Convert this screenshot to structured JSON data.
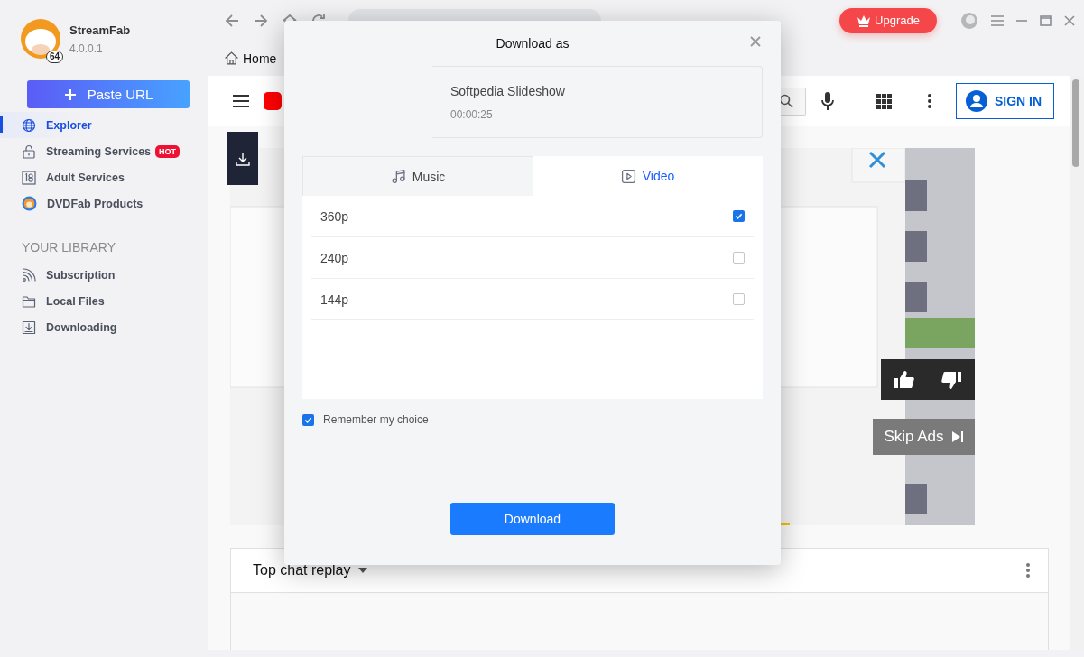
{
  "sidebar": {
    "app_name": "StreamFab",
    "version": "4.0.0.1",
    "logo_badge": "64",
    "paste_button": "Paste URL",
    "nav": [
      {
        "label": "Explorer",
        "selected": true
      },
      {
        "label": "Streaming Services",
        "badge": "HOT",
        "selected": false
      },
      {
        "label": "Adult Services",
        "selected": false
      },
      {
        "label": "DVDFab Products",
        "selected": false
      }
    ],
    "library_heading": "YOUR LIBRARY",
    "library": [
      {
        "label": "Subscription",
        "selected": false
      },
      {
        "label": "Local Files",
        "selected": false
      },
      {
        "label": "Downloading",
        "selected": false
      }
    ]
  },
  "toolbar": {
    "upgrade_button": "Upgrade"
  },
  "home_tab": "Home",
  "page": {
    "sign_in": "SIGN IN",
    "skip_ads": "Skip Ads",
    "chat_header": "Top chat replay"
  },
  "dialog": {
    "title": "Download as",
    "video": {
      "title": "Softpedia Slideshow",
      "duration": "00:00:25"
    },
    "tabs": [
      {
        "label": "Music",
        "selected": false
      },
      {
        "label": "Video",
        "selected": true
      }
    ],
    "qualities": [
      {
        "label": "360p",
        "checked": true
      },
      {
        "label": "240p",
        "checked": false
      },
      {
        "label": "144p",
        "checked": false
      }
    ],
    "remember": {
      "label": "Remember my choice",
      "checked": true
    },
    "download_button": "Download"
  }
}
